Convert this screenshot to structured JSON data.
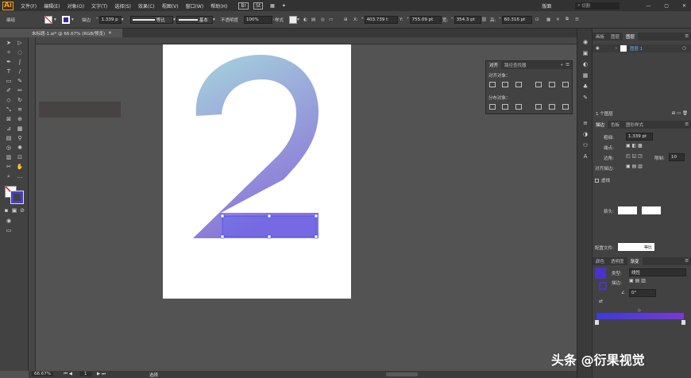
{
  "menubar": {
    "logo": "Ai",
    "items": [
      "文件(F)",
      "编辑(E)",
      "对象(O)",
      "文字(T)",
      "选择(S)",
      "效果(C)",
      "视图(V)",
      "窗口(W)",
      "帮助(H)"
    ],
    "workspace": "版面",
    "search_placeholder": "切割"
  },
  "control": {
    "object_type": "编组",
    "stroke_label": "描边",
    "stroke_weight": "1.339 p",
    "profile_label": "等比",
    "brush_label": "基本",
    "opacity_label": "不透明度",
    "opacity_value": "100%",
    "style_label": "样式",
    "x_value": "403.739 t",
    "y_value": "755.09 pt",
    "w_value": "354.3 pt",
    "h_value": "60.316 pt"
  },
  "doc": {
    "tab_title": "未标题-1.ai* @ 66.67% (RGB/预览)"
  },
  "status": {
    "zoom": "66.67%",
    "page": "1",
    "tool": "选择"
  },
  "align_panel": {
    "tabs": [
      "对齐",
      "路径查找器"
    ],
    "align_objects": "对齐对象：",
    "distribute_objects": "分布对象："
  },
  "layers_panel": {
    "tabs": [
      "画板",
      "图层",
      "图层"
    ],
    "layer_name": "图层 1",
    "layer_count": "1 个图层"
  },
  "stroke_panel": {
    "tabs": [
      "描边",
      "色板",
      "图形样式"
    ],
    "weight_label": "粗细:",
    "weight_value": "1.339 pt",
    "cap_label": "端点:",
    "corner_label": "边角:",
    "limit_label": "限制:",
    "limit_value": "10",
    "align_label": "对齐描边:",
    "dashed_label": "虚线",
    "arrow_label": "箭头:",
    "profile_label": "配置文件:",
    "profile_value": "等比"
  },
  "gradient_panel": {
    "tabs": [
      "颜色",
      "透明度",
      "渐变"
    ],
    "type_label": "类型:",
    "type_value": "线性",
    "stroke_label": "描边:",
    "angle_value": "0°"
  },
  "colors": {
    "gradient_start": "#a6d4dc",
    "gradient_end": "#8a74d8",
    "selection_blue": "#3a4bff",
    "panel_gradient_start": "#3b3ae0",
    "panel_gradient_end": "#7a38d8"
  },
  "watermark": "头条 @衍果视觉"
}
